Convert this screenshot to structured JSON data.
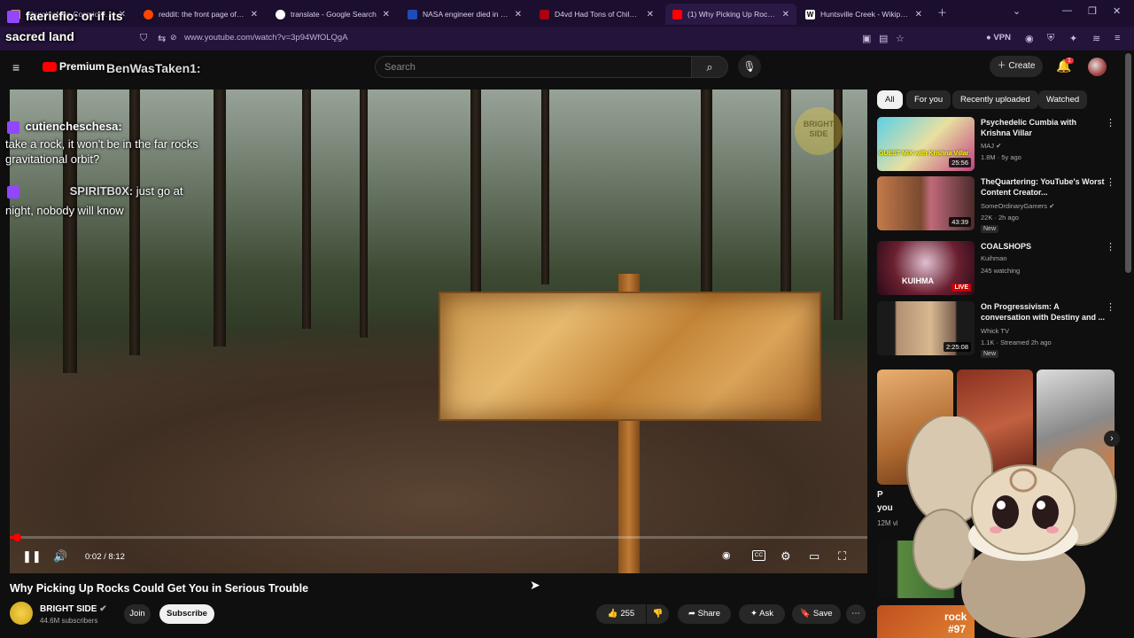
{
  "browser": {
    "tabs": [
      {
        "title": "Church of the Cosmic Skull",
        "fav": "#c94"
      },
      {
        "title": "reddit: the front page of the",
        "fav": "#ff4500"
      },
      {
        "title": "translate - Google Search",
        "fav": "#4285f4"
      },
      {
        "title": "NASA engineer died in fiery Ala",
        "fav": "#1e4db7"
      },
      {
        "title": "D4vd Had Tons of Child Pornog",
        "fav": "#a01"
      },
      {
        "title": "(1) Why Picking Up Rocks C",
        "fav": "#f00"
      },
      {
        "title": "Huntsville Creek - Wikipedia",
        "fav": "#fff"
      }
    ],
    "url": "www.youtube.com/watch?v=3p94WfOLQgA",
    "vpn_label": "VPN"
  },
  "youtube_header": {
    "logo_text": "Premium",
    "search_placeholder": "Search",
    "create_label": "Create",
    "notification_count": "1"
  },
  "chat_overlay": {
    "top_line_user": "faeriefio:",
    "top_line_text": "or if its",
    "top_line_cont": "sacred land",
    "user2": "BenWasTaken1:",
    "msg3_user": "cutiencheschesa:",
    "msg3_text": "take a rock, it won't be in the far rocks",
    "msg3_text2": "gravitational orbit?",
    "msg4_user": "SPIRITB0X:",
    "msg4_text": "just go at",
    "msg4_text2": "night, nobody will know"
  },
  "player": {
    "watermark": "BRIGHT SIDE",
    "current_time": "0:02",
    "duration": "8:12",
    "time_separator": " / ",
    "cc_label": "CC",
    "progress": 0.004
  },
  "video_info": {
    "title": "Why Picking Up Rocks Could Get You in Serious Trouble",
    "channel": "BRIGHT SIDE",
    "subscribers": "44.6M subscribers",
    "join_label": "Join",
    "subscribe_label": "Subscribe",
    "likes": "255",
    "share_label": "Share",
    "ask_label": "Ask",
    "save_label": "Save"
  },
  "sidebar": {
    "chips": [
      "All",
      "For you",
      "Recently uploaded",
      "Watched"
    ],
    "recommendations": [
      {
        "title": "Psychedelic Cumbia with Krishna Villar",
        "channel": "MAJ",
        "meta": "1.8M · 5y ago",
        "duration": "25:56",
        "thumb_text": "GUEST MIX with Krishna Villar"
      },
      {
        "title": "TheQuartering: YouTube's Worst Content Creator...",
        "channel": "SomeOrdinaryGamers",
        "meta": "22K · 2h ago",
        "duration": "43:39",
        "badge": "New"
      },
      {
        "title": "COALSHOPS",
        "channel": "Kuihman",
        "meta": "245 watching",
        "live_label": "LIVE",
        "thumb_text": "KUIHMA"
      },
      {
        "title": "On Progressivism: A conversation with Destiny and ...",
        "channel": "Whick TV",
        "meta": "1.1K · Streamed 2h ago",
        "duration": "2:25:08",
        "badge": "New"
      }
    ],
    "shorts_partial": {
      "label1": "P",
      "label2": "you",
      "views": "12M vi"
    },
    "bottom_partial": {
      "thumb_text1": "rock",
      "thumb_text2": "#97"
    }
  },
  "colors": {
    "accent": "#ff0000",
    "background": "#0f0f0f",
    "browser_tabbar": "#1c0e2e",
    "twitch": "#9146ff"
  }
}
